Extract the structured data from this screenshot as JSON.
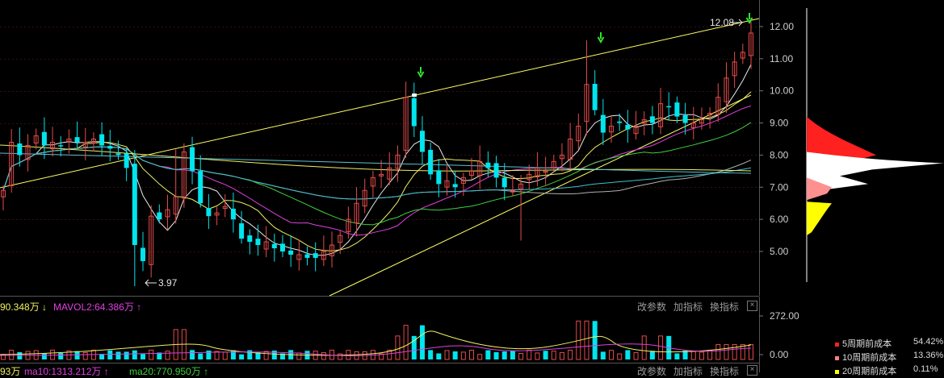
{
  "chart_data": {
    "type": "candlestick",
    "price_axis": {
      "ticks": [
        "12.00",
        "11.00",
        "10.00",
        "9.00",
        "8.00",
        "7.00",
        "6.00",
        "5.00"
      ],
      "min": 4.0,
      "max": 12.8
    },
    "annotations": {
      "high_label": "12.08",
      "low_label": "3.97"
    },
    "colors": {
      "up": "#e64b4b",
      "down": "#00e5ee",
      "ma_white": "#e8e8e8",
      "ma_yellow": "#f0f060",
      "ma_magenta": "#e040e0",
      "ma_green": "#40d040",
      "ma_gray": "#b0b0b0",
      "ma_cyan": "#40c0d0",
      "trend": "#ffff66",
      "marker": "#30e030"
    },
    "candles_seed": [
      6.9,
      8.4,
      8.0,
      8.3,
      8.6,
      8.3,
      8.4,
      8.3,
      8.5,
      8.4,
      8.4,
      8.5,
      8.3,
      8.2,
      8.0,
      7.6,
      5.2,
      4.7,
      6.1,
      6.0,
      6.3,
      6.7,
      8.1,
      7.5,
      6.5,
      6.1,
      6.2,
      6.4,
      6.0,
      5.4,
      5.3,
      5.2,
      5.3,
      5.1,
      5.0,
      4.9,
      4.9,
      4.8,
      4.8,
      5.0,
      5.2,
      5.5,
      6.0,
      6.5,
      6.9,
      7.3,
      7.4,
      7.6,
      8.0,
      9.8,
      8.9,
      8.1,
      7.4,
      7.1,
      7.2,
      7.0,
      7.3,
      7.5,
      7.8,
      7.6,
      7.3,
      7.0,
      6.9,
      7.1,
      7.4,
      7.6,
      7.5,
      7.8,
      8.0,
      8.5,
      8.9,
      10.2,
      9.4,
      8.7,
      8.9,
      9.0,
      8.8,
      8.9,
      9.1,
      9.0,
      9.6,
      9.5,
      9.2,
      9.0,
      9.0,
      9.1,
      9.3,
      9.8,
      10.4,
      10.9,
      11.2,
      11.8
    ],
    "volume": {
      "mavol1_label": "90.348万",
      "mavol2_label": "MAVOL2:64.386万",
      "axis_ticks": [
        "272.00",
        "0.00"
      ],
      "ma_line_labels": [
        "93万",
        "ma10:1313.212万",
        "ma20:770.950万"
      ]
    },
    "cost_distribution": [
      {
        "label": "5周期前成本",
        "value": "54.42%",
        "color": "#ff2020"
      },
      {
        "label": "10周期前成本",
        "value": "13.36%",
        "color": "#ff8080"
      },
      {
        "label": "20周期前成本",
        "value": "0.11%",
        "color": "#ffff00"
      }
    ]
  },
  "toolbar": {
    "buttons": [
      "改参数",
      "加指标",
      "换指标"
    ],
    "close": "×"
  }
}
